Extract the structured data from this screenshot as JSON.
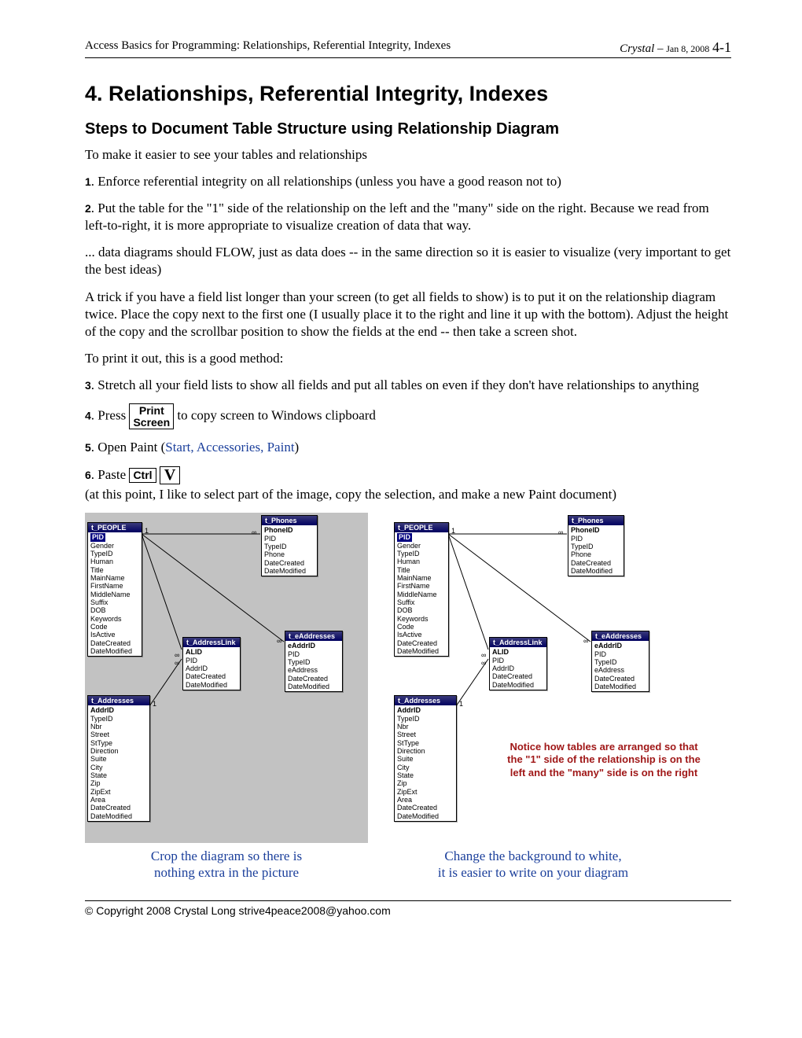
{
  "header": {
    "left": "Access Basics for Programming: Relationships, Referential Integrity, Indexes",
    "author": "Crystal",
    "sep": " – ",
    "date": "Jan 8, 2008",
    "page": "4-1"
  },
  "h1": "4.   Relationships, Referential Integrity, Indexes",
  "h2": "Steps to Document Table Structure using Relationship Diagram",
  "p_intro": "To make it easier to see your tables and relationships",
  "step1_num": "1",
  "step1": ". Enforce referential integrity on all relationships (unless you have a good reason not to)",
  "step2_num": "2",
  "step2": ". Put the table for the \"1\" side of the relationship on the left and the \"many\" side on the right. Because we read from left-to-right, it is more appropriate to visualize creation of data that way.",
  "p_flow": "... data diagrams should FLOW, just as data does -- in the same direction so it is easier to visualize (very important to get the best ideas)",
  "p_trick": "A trick if you have a field list longer than your screen (to get all fields to show) is to put it on the relationship diagram twice.  Place the copy next to the first one (I usually place it to the right and line it up with the bottom).  Adjust the height of the copy and the scrollbar position to show the fields at the end -- then take a screen shot.",
  "p_print": "To print it out, this is a good method:",
  "step3_num": "3",
  "step3": ". Stretch all your field lists to show all fields and put all tables on even if they don't have relationships to anything",
  "step4_num": "4",
  "step4_a": ". Press ",
  "key_print1": "Print",
  "key_print2": "Screen",
  "step4_b": " to copy screen to Windows clipboard",
  "step5_num": "5",
  "step5_a": ". Open Paint (",
  "step5_link": "Start, Accessories, Paint",
  "step5_b": ")",
  "step6_num": "6",
  "step6_a": ". Paste ",
  "key_ctrl": "Ctrl",
  "key_v": "V",
  "step6_b": "(at this point, I like to select part of the image, copy the selection, and make a new Paint document)",
  "tables": {
    "t_PEOPLE": {
      "title": "t_PEOPLE",
      "pk": "PID",
      "fields": [
        "Gender",
        "TypeID",
        "Human",
        "Title",
        "MainName",
        "FirstName",
        "MiddleName",
        "Suffix",
        "DOB",
        "Keywords",
        "Code",
        "IsActive",
        "DateCreated",
        "DateModified"
      ]
    },
    "t_Phones": {
      "title": "t_Phones",
      "pk": "PhoneID",
      "fields": [
        "PID",
        "TypeID",
        "Phone",
        "DateCreated",
        "DateModified"
      ]
    },
    "t_AddressLink": {
      "title": "t_AddressLink",
      "pk": "ALID",
      "fields": [
        "PID",
        "AddrID",
        "DateCreated",
        "DateModified"
      ]
    },
    "t_eAddresses": {
      "title": "t_eAddresses",
      "pk": "eAddrID",
      "fields": [
        "PID",
        "TypeID",
        "eAddress",
        "DateCreated",
        "DateModified"
      ]
    },
    "t_Addresses": {
      "title": "t_Addresses",
      "pk": "AddrID",
      "fields": [
        "TypeID",
        "Nbr",
        "Street",
        "StType",
        "Direction",
        "Suite",
        "City",
        "State",
        "Zip",
        "ZipExt",
        "Area",
        "DateCreated",
        "DateModified"
      ]
    }
  },
  "callout": "Notice how tables are arranged so that the \"1\" side of the relationship is on the left and the \"many\" side is on the right",
  "caption_left_1": "Crop the diagram so there is",
  "caption_left_2": "nothing extra in the picture",
  "caption_right_1": "Change the background to white,",
  "caption_right_2": "it is easier to write on your diagram",
  "footer": "© Copyright 2008 Crystal Long      strive4peace2008@yahoo.com"
}
